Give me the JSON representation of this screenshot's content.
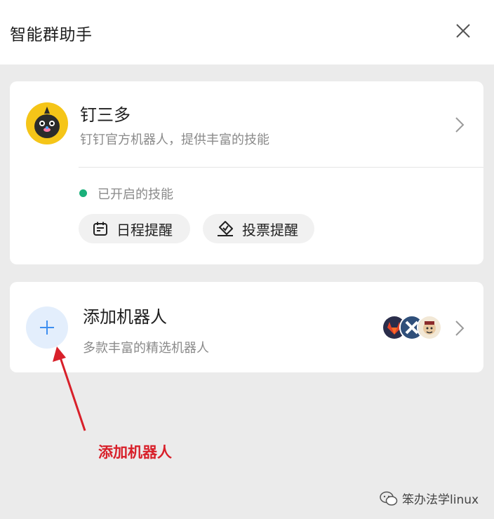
{
  "header": {
    "title": "智能群助手",
    "close_icon": "close-icon"
  },
  "bot_card": {
    "name": "钉三多",
    "description": "钉钉官方机器人，提供丰富的技能",
    "status_label": "已开启的技能",
    "status_color": "#1ab07a",
    "skills": [
      {
        "label": "日程提醒",
        "icon": "calendar-icon"
      },
      {
        "label": "投票提醒",
        "icon": "vote-icon"
      }
    ]
  },
  "add_card": {
    "title": "添加机器人",
    "description": "多款丰富的精选机器人",
    "accent": "#e3eefc"
  },
  "annotation": {
    "label": "添加机器人",
    "color": "#d8202a"
  },
  "watermark": {
    "label": "笨办法学linux"
  }
}
